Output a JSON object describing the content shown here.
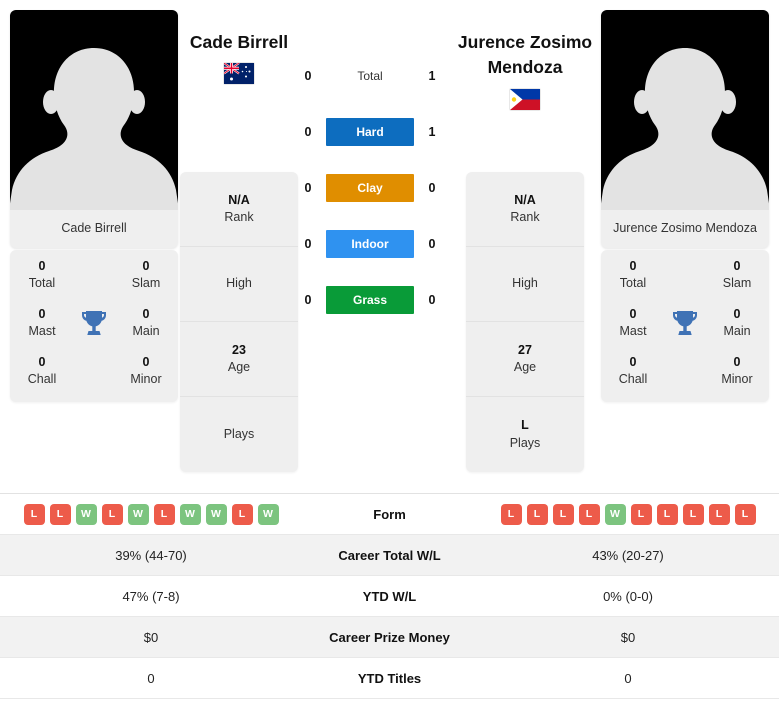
{
  "players": {
    "left": {
      "name": "Cade Birrell",
      "photo_caption": "Cade Birrell",
      "flag": "australia-flag",
      "rank": "N/A",
      "rank_label": "Rank",
      "high": "",
      "high_label": "High",
      "age": "23",
      "age_label": "Age",
      "plays": "",
      "plays_label": "Plays",
      "titles": {
        "total": "0",
        "total_label": "Total",
        "slam": "0",
        "slam_label": "Slam",
        "mast": "0",
        "mast_label": "Mast",
        "main": "0",
        "main_label": "Main",
        "chall": "0",
        "chall_label": "Chall",
        "minor": "0",
        "minor_label": "Minor"
      },
      "form": [
        "L",
        "L",
        "W",
        "L",
        "W",
        "L",
        "W",
        "W",
        "L",
        "W"
      ],
      "career_wl": "39% (44-70)",
      "ytd_wl": "47% (7-8)",
      "prize_money": "$0",
      "ytd_titles": "0"
    },
    "right": {
      "name": "Jurence Zosimo Mendoza",
      "photo_caption": "Jurence Zosimo Mendoza",
      "flag": "philippines-flag",
      "rank": "N/A",
      "rank_label": "Rank",
      "high": "",
      "high_label": "High",
      "age": "27",
      "age_label": "Age",
      "plays": "L",
      "plays_label": "Plays",
      "titles": {
        "total": "0",
        "total_label": "Total",
        "slam": "0",
        "slam_label": "Slam",
        "mast": "0",
        "mast_label": "Mast",
        "main": "0",
        "main_label": "Main",
        "chall": "0",
        "chall_label": "Chall",
        "minor": "0",
        "minor_label": "Minor"
      },
      "form": [
        "L",
        "L",
        "L",
        "L",
        "W",
        "L",
        "L",
        "L",
        "L",
        "L"
      ],
      "career_wl": "43% (20-27)",
      "ytd_wl": "0% (0-0)",
      "prize_money": "$0",
      "ytd_titles": "0"
    }
  },
  "head_to_head": [
    {
      "surface": "Total",
      "left": "0",
      "right": "1",
      "color": ""
    },
    {
      "surface": "Hard",
      "left": "0",
      "right": "1",
      "color": "#0d6dbf"
    },
    {
      "surface": "Clay",
      "left": "0",
      "right": "0",
      "color": "#e08e00"
    },
    {
      "surface": "Indoor",
      "left": "0",
      "right": "0",
      "color": "#2f92f0"
    },
    {
      "surface": "Grass",
      "left": "0",
      "right": "0",
      "color": "#099b38"
    }
  ],
  "table": {
    "rows": [
      {
        "label": "Form",
        "key": "form",
        "type": "badges"
      },
      {
        "label": "Career Total W/L",
        "key": "career_wl",
        "type": "text"
      },
      {
        "label": "YTD W/L",
        "key": "ytd_wl",
        "type": "text"
      },
      {
        "label": "Career Prize Money",
        "key": "prize_money",
        "type": "text"
      },
      {
        "label": "YTD Titles",
        "key": "ytd_titles",
        "type": "text"
      }
    ]
  },
  "colors": {
    "win_badge": "#7cc47f",
    "loss_badge": "#ed5b4a",
    "card_bg": "#efefef",
    "row_alt_bg": "#f2f2f2",
    "trophy": "#3f72b5"
  }
}
